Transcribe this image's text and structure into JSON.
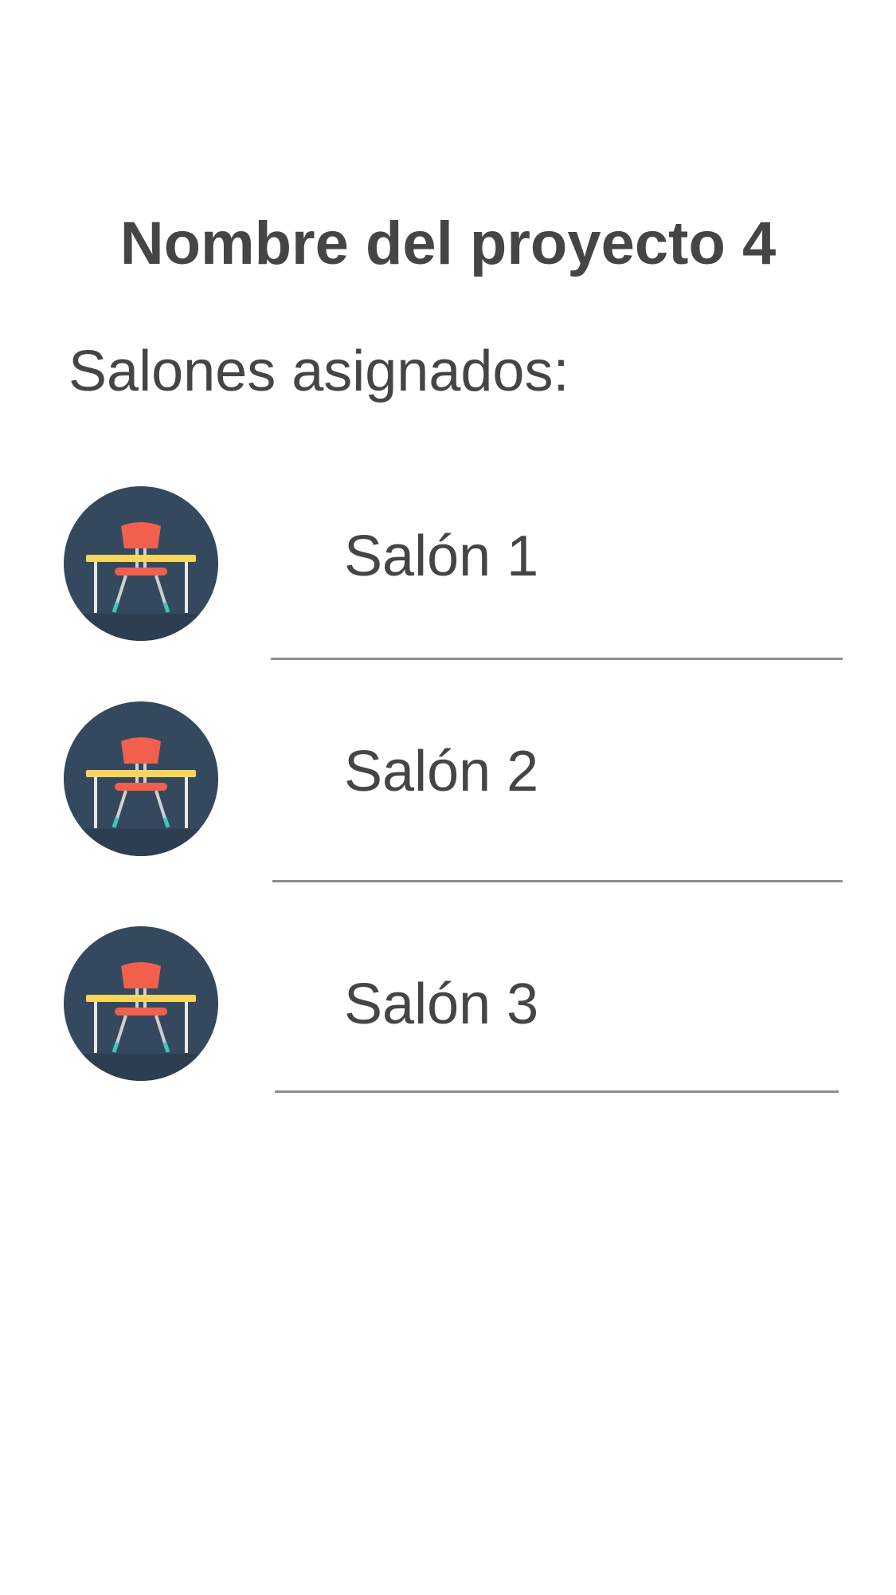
{
  "project": {
    "title": "Nombre del proyecto 4"
  },
  "rooms_section": {
    "label": "Salones asignados:"
  },
  "rooms": [
    {
      "name": "Salón 1",
      "icon": "classroom-desk-icon"
    },
    {
      "name": "Salón 2",
      "icon": "classroom-desk-icon"
    },
    {
      "name": "Salón 3",
      "icon": "classroom-desk-icon"
    }
  ],
  "colors": {
    "text": "#454545",
    "icon_background": "#34495e",
    "chair": "#f0604c",
    "desk": "#f9d65b",
    "chair_feet": "#3fc7b3",
    "divider": "#8e8e8e"
  }
}
